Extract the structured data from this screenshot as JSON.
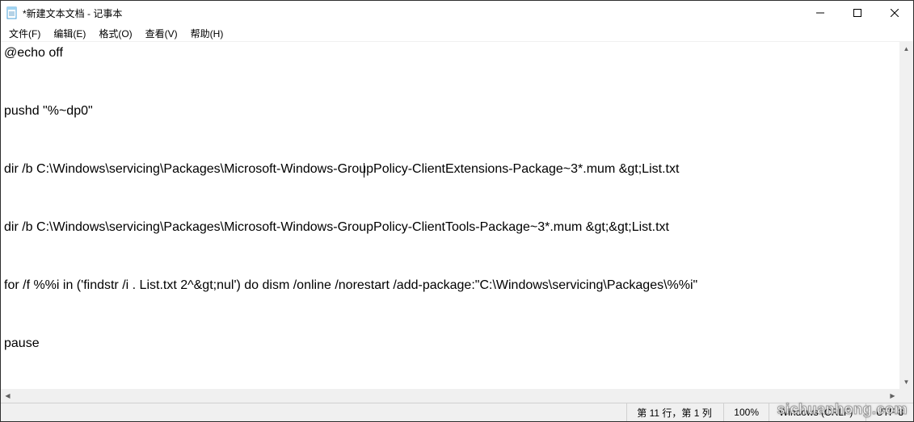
{
  "window": {
    "title": "*新建文本文档 - 记事本"
  },
  "menu": {
    "file": "文件(F)",
    "edit": "编辑(E)",
    "format": "格式(O)",
    "view": "查看(V)",
    "help": "帮助(H)"
  },
  "editor": {
    "content": "@echo off\n\n\npushd \"%~dp0\"\n\n\ndir /b C:\\Windows\\servicing\\Packages\\Microsoft-Windows-GroupPolicy-ClientExtensions-Package~3*.mum &gt;List.txt\n\n\ndir /b C:\\Windows\\servicing\\Packages\\Microsoft-Windows-GroupPolicy-ClientTools-Package~3*.mum &gt;&gt;List.txt\n\n\nfor /f %%i in ('findstr /i . List.txt 2^&gt;nul') do dism /online /norestart /add-package:\"C:\\Windows\\servicing\\Packages\\%%i\"\n\n\npause"
  },
  "status": {
    "position": "第 11 行，第 1 列",
    "zoom": "100%",
    "lineending": "Windows (CRLF)",
    "encoding": "UTF-8"
  },
  "watermark": "sichuanhong.com"
}
